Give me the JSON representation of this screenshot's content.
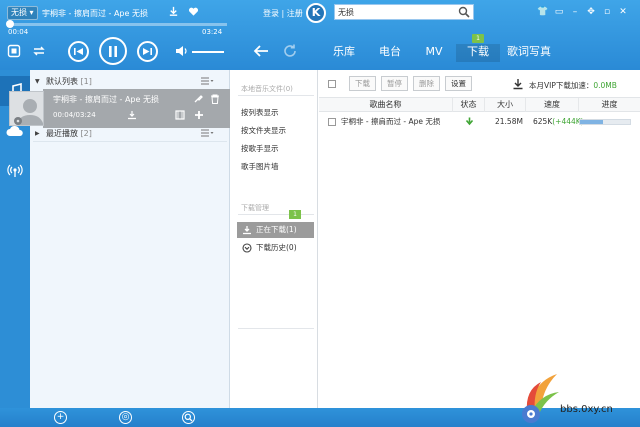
{
  "topbar": {
    "quality": "无损",
    "now_title": "宇桐非 - 擦肩而过 - Ape 无损",
    "login": "登录 | 注册",
    "logo_letter": "K",
    "search_value": "无损",
    "progress_fraction": 0.0,
    "time_elapsed": "00:04",
    "time_total": "03:24",
    "volume_fraction": 1.0
  },
  "nav": {
    "tabs": [
      {
        "label": "乐库",
        "active": false
      },
      {
        "label": "电台",
        "active": false
      },
      {
        "label": "MV",
        "active": false
      },
      {
        "label": "下载",
        "active": true,
        "badge": "1"
      },
      {
        "label": "歌词写真",
        "active": false
      }
    ]
  },
  "playlist": {
    "default_list": {
      "name": "默认列表",
      "count": "[1]"
    },
    "now_playing": {
      "title": "宇桐非 - 擦肩而过 - Ape 无损",
      "time": "00:04/03:24"
    },
    "recent": {
      "name": "最近播放",
      "count": "[2]"
    }
  },
  "download_side": {
    "local_heading": "本地音乐文件(0)",
    "links": [
      "按列表显示",
      "按文件夹显示",
      "按歌手显示",
      "歌手图片墙"
    ],
    "manage_heading": "下载管理",
    "downloading": {
      "label": "正在下载(1)",
      "badge": "1"
    },
    "history": {
      "label": "下载历史(0)"
    }
  },
  "download_table": {
    "toolbar": {
      "download": "下载",
      "pause": "暂停",
      "delete": "删除",
      "settings": "设置",
      "vip_label": "本月VIP下载加速：",
      "vip_speed": "0.0MB"
    },
    "columns": [
      "歌曲名称",
      "状态",
      "大小",
      "速度",
      "进度"
    ],
    "rows": [
      {
        "name": "宇桐非 - 擦肩而过 - Ape 无损",
        "size": "21.58M",
        "speed": "625K",
        "speed_boost": "(+444K)",
        "progress": 0.45
      }
    ]
  },
  "watermark": {
    "text": "bbs.0xy.cn"
  },
  "colors": {
    "primary": "#2a8ad6",
    "accent_green": "#7cc24a",
    "selected_gray": "#9b9b9b"
  }
}
